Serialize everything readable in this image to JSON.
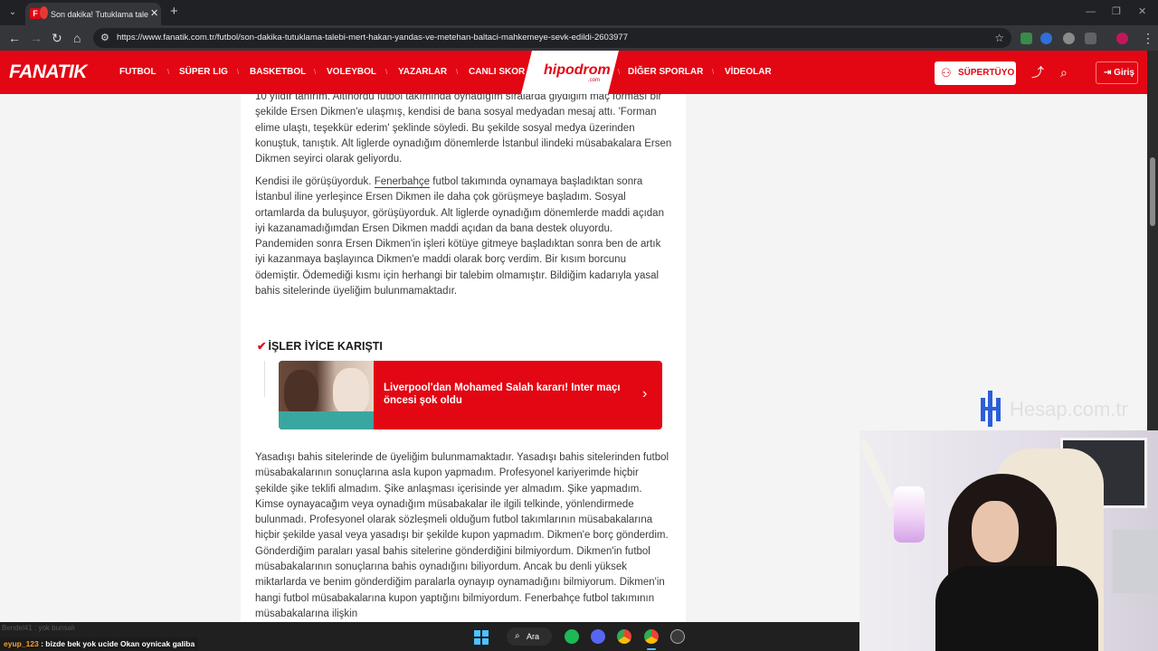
{
  "browser": {
    "tab_title": "Son dakika! Tutuklama talebi: Mert Hakan Yandaş",
    "tab_close": "✕",
    "new_tab": "+",
    "url": "https://www.fanatik.com.tr/futbol/son-dakika-tutuklama-talebi-mert-hakan-yandas-ve-metehan-baltaci-mahkemeye-sevk-edildi-2603977",
    "ext_badge": "12"
  },
  "site": {
    "logo": "FANATIK",
    "nav_items": [
      "FUTBOL",
      "SÜPER LIG",
      "BASKETBOL",
      "VOLEYBOL",
      "YAZARLAR",
      "CANLI SKOR",
      "DİĞER SPORLAR",
      "VİDEOLAR"
    ],
    "hipodrom": "hipodrom",
    "hipodrom_sub": ".com",
    "supertuyo": "SÜPERTÜYO",
    "giris": "Giriş"
  },
  "article": {
    "para1": "10 yıldır tanırım. Altınordu futbol takımında oynadığım sıralarda giydiğim maç forması bir şekilde Ersen Dikmen'e ulaşmış, kendisi de bana sosyal medyadan mesaj attı. 'Forman elime ulaştı, teşekkür ederim' şeklinde söyledi. Bu şekilde sosyal medya üzerinden konuştuk, tanıştık. Alt liglerde oynadığım dönemlerde İstanbul ilindeki müsabakalara Ersen Dikmen seyirci olarak geliyordu.",
    "para2_link": "Fenerbahçe",
    "para2_a": "Kendisi ile görüşüyorduk. ",
    "para2_b": " futbol takımında oynamaya başladıktan sonra İstanbul iline yerleşince Ersen Dikmen ile daha çok görüşmeye başladım. Sosyal ortamlarda da buluşuyor, görüşüyorduk. Alt liglerde oynadığım dönemlerde maddi açıdan iyi kazanamadığımdan Ersen Dikmen maddi açıdan da bana destek oluyordu. Pandemiden sonra Ersen Dikmen'in işleri kötüye gitmeye başladıktan sonra ben de artık iyi kazanmaya başlayınca Dikmen'e maddi olarak borç verdim. Bir kısım borcunu ödemiştir. Ödemediği kısmı için herhangi bir talebim olmamıştır. Bildiğim kadarıyla yasal bahis sitelerinde üyeliğim bulunmamaktadır.",
    "section_title": "İŞLER İYİCE KARIŞTI",
    "card_text": "Liverpool'dan Mohamed Salah kararı! Inter maçı öncesi şok oldu",
    "card_arrow": "›",
    "para3": "Yasadışı bahis sitelerinde de üyeliğim bulunmamaktadır. Yasadışı bahis sitelerinden futbol müsabakalarının sonuçlarına asla kupon yapmadım. Profesyonel kariyerimde hiçbir şekilde şike teklifi almadım. Şike anlaşması içerisinde yer almadım. Şike yapmadım. Kimse oynayacağım veya oynadığım müsabakalar ile ilgili telkinde, yönlendirmede bulunmadı. Profesyonel olarak sözleşmeli olduğum futbol takımlarının müsabakalarına hiçbir şekilde yasal veya yasadışı bir şekilde kupon yapmadım. Dikmen'e borç gönderdim. Gönderdiğim paraları yasal bahis sitelerine gönderdiğini bilmiyordum. Dikmen'in futbol müsabakalarının sonuçlarına bahis oynadığını biliyordum. Ancak bu denli yüksek miktarlarda ve benim gönderdiğim paralarla oynayıp oynamadığını bilmiyorum. Dikmen'in hangi futbol müsabakalarına kupon yaptığını bilmiyordum. Fenerbahçe futbol takımının müsabakalarına ilişkin"
  },
  "overlay": {
    "watermark": "Hesap.com.tr",
    "chat_line1": "Bendel41 : yok bunsalı",
    "chat_user": "eyup_123",
    "chat_msg": " : bizde bek yok ucide Okan oynicak galiba"
  },
  "taskbar": {
    "search_label": "Ara"
  },
  "colors": {
    "brand_red": "#e30613",
    "chrome_dark": "#202124",
    "chrome_toolbar": "#35363a"
  }
}
